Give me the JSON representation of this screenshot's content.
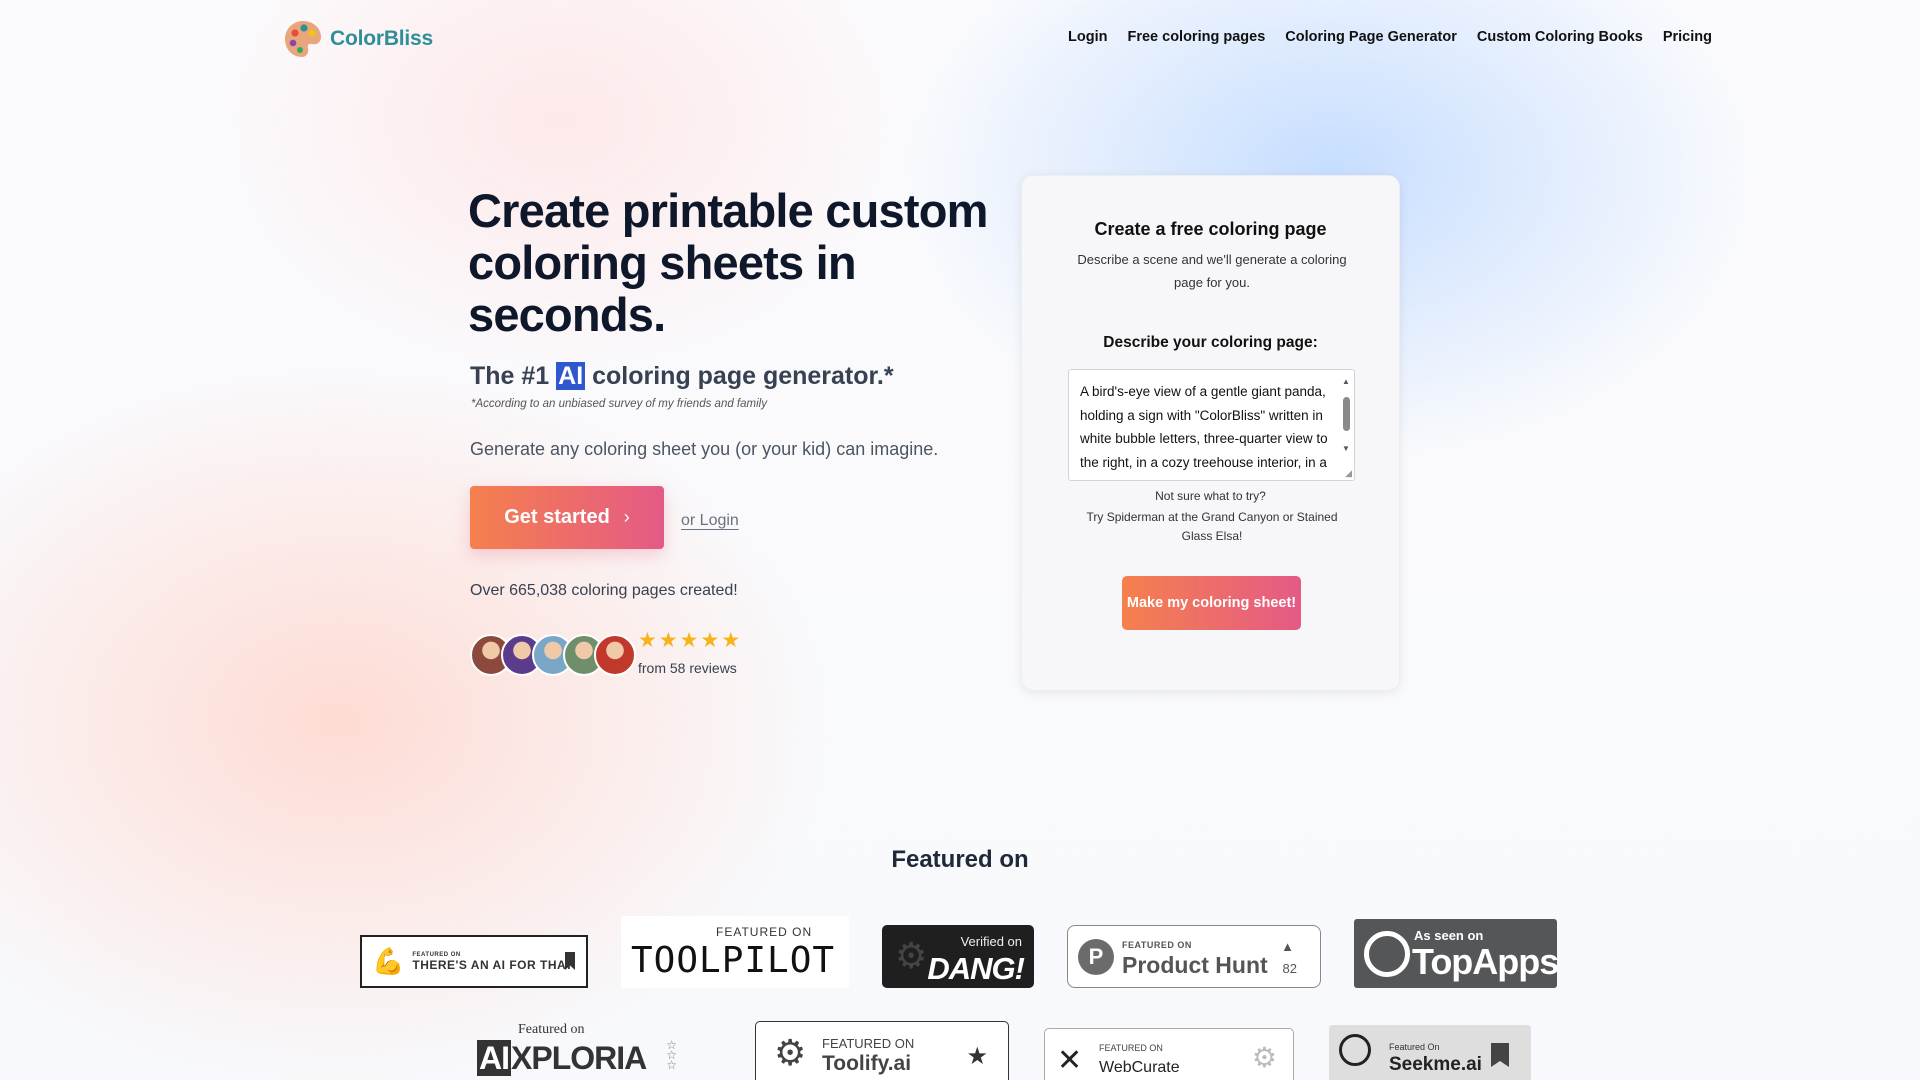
{
  "brand": {
    "name": "ColorBliss"
  },
  "nav": {
    "links": [
      "Login",
      "Free coloring pages",
      "Coloring Page Generator",
      "Custom Coloring Books",
      "Pricing"
    ]
  },
  "hero": {
    "title": "Create printable custom coloring sheets in seconds.",
    "tagline_before": "The #1 ",
    "tagline_highlight": "AI",
    "tagline_after": " coloring page generator.*",
    "footnote": "*According to an unbiased survey of my friends and family",
    "subtitle": "Generate any coloring sheet you (or your kid) can imagine.",
    "cta_label": "Get started",
    "cta_chevron": "›",
    "login_link": "or Login",
    "pages_created": "Over 665,038 coloring pages created!",
    "stars": [
      "★",
      "★",
      "★",
      "★",
      "★"
    ],
    "rating": 5,
    "reviews": "from 58 reviews",
    "avatar_colors": [
      "#8b4a3c",
      "#5b3b8c",
      "#7aa7c7",
      "#6f8f6a",
      "#c0392b"
    ]
  },
  "card": {
    "title": "Create a free coloring page",
    "description": "Describe a scene and we'll generate a coloring page for you.",
    "label": "Describe your coloring page:",
    "prompt_value": "A bird's-eye view of a gentle giant panda, holding a sign with \"ColorBliss\" written in white bubble letters, three-quarter view to the right, in a cozy treehouse interior, in a whimsical style",
    "hint_title": "Not sure what to try?",
    "hint_body": "Try Spiderman at the Grand Canyon or Stained Glass Elsa!",
    "submit_label": "Make my coloring sheet!"
  },
  "featured": {
    "title": "Featured on",
    "badges": {
      "aift": {
        "small": "FEATURED ON",
        "big": "THERE'S AN AI FOR THAT"
      },
      "toolpilot": {
        "small": "FEATURED ON",
        "big": "TOOLPILOT"
      },
      "dang": {
        "small": "Verified on",
        "big": "DANG!"
      },
      "producthunt": {
        "letter": "P",
        "small": "FEATURED ON",
        "big": "Product Hunt",
        "votes": "82"
      },
      "topapps": {
        "small": "As seen on",
        "big": "TopApps"
      },
      "aixploria": {
        "small": "Featured on",
        "ai": "AI",
        "big": "XPLORIA"
      },
      "toolify": {
        "small": "FEATURED ON",
        "big": "Toolify.ai"
      },
      "webcurate": {
        "small": "FEATURED ON",
        "big": "WebCurate"
      },
      "seekme": {
        "small": "Featured On",
        "big": "Seekme.ai"
      }
    }
  },
  "colors": {
    "brand_teal": "#2f8f98",
    "cta_start": "#f5804d",
    "cta_end": "#e45a86",
    "star": "#f6b31b",
    "highlight": "#2f58cf"
  }
}
